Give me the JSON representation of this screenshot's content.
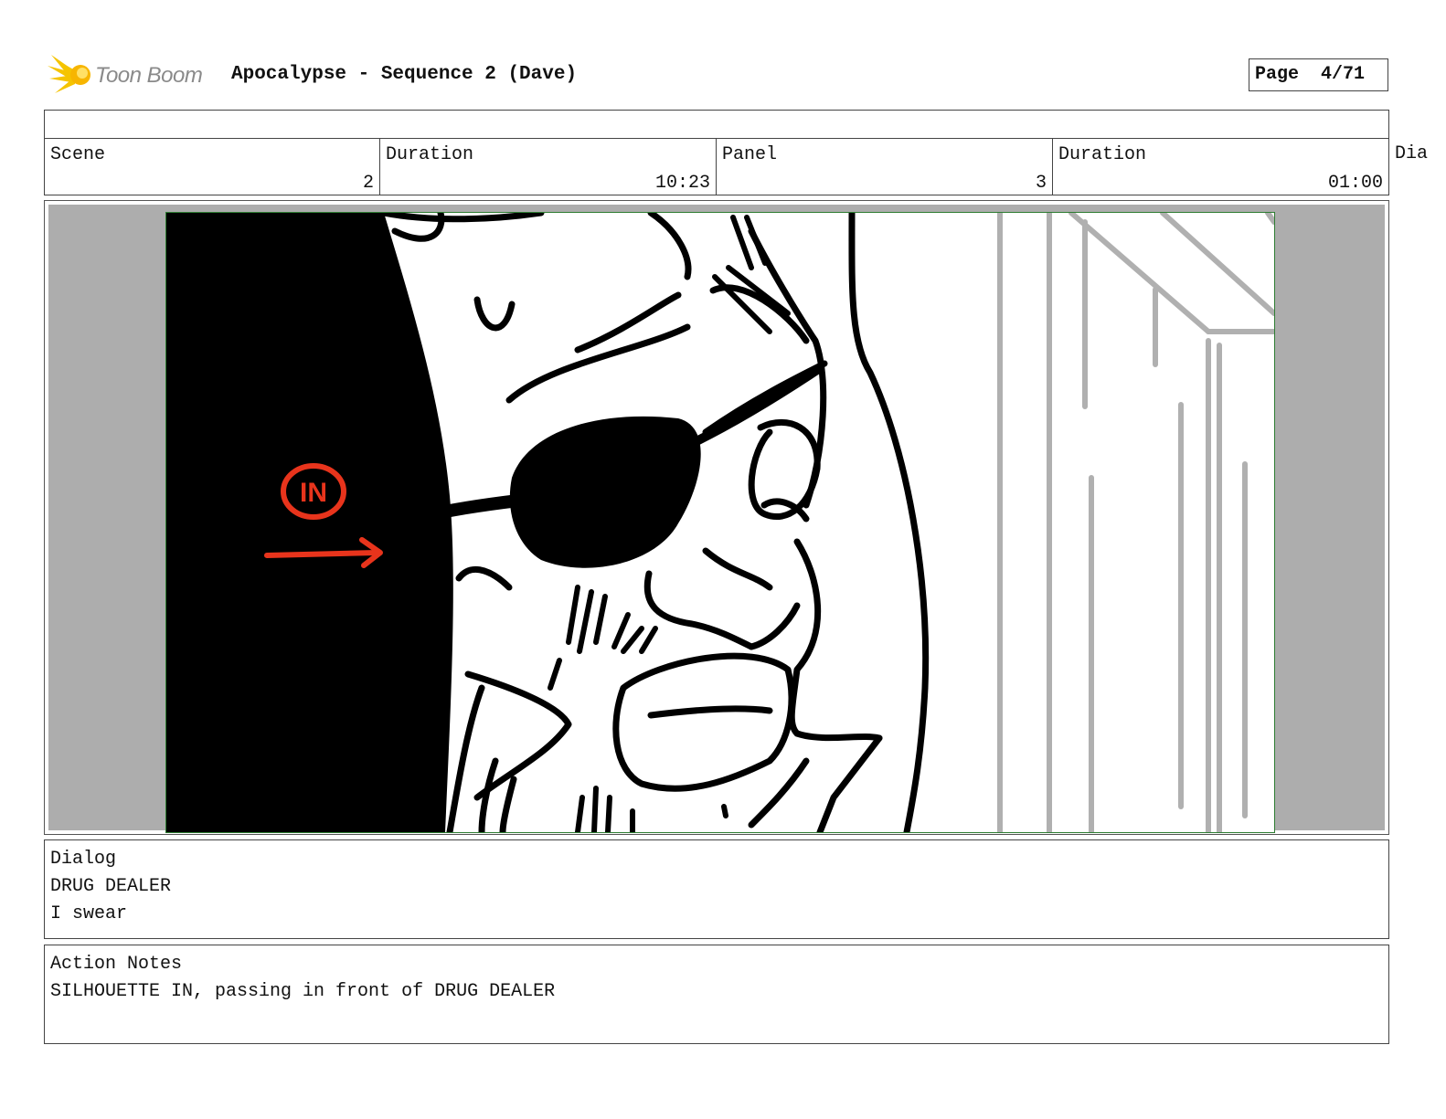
{
  "header": {
    "brand": "Toon Boom",
    "title": "Apocalypse - Sequence 2 (Dave)",
    "page_label": "Page",
    "page_value": "4/71"
  },
  "info": {
    "scene_label": "Scene",
    "scene_value": "2",
    "scene_duration_label": "Duration",
    "scene_duration_value": "10:23",
    "panel_label": "Panel",
    "panel_value": "3",
    "panel_duration_label": "Duration",
    "panel_duration_value": "01:00",
    "extra_label": "Dia"
  },
  "panel": {
    "annotation": "IN",
    "annotation_color": "#e8341c",
    "frame_color": "#2e7d32",
    "letterbox_color": "#adadad"
  },
  "dialog": {
    "label": "Dialog",
    "character": "DRUG DEALER",
    "line": "I swear"
  },
  "notes": {
    "label": "Action Notes",
    "text": "SILHOUETTE IN, passing in front of DRUG DEALER"
  }
}
